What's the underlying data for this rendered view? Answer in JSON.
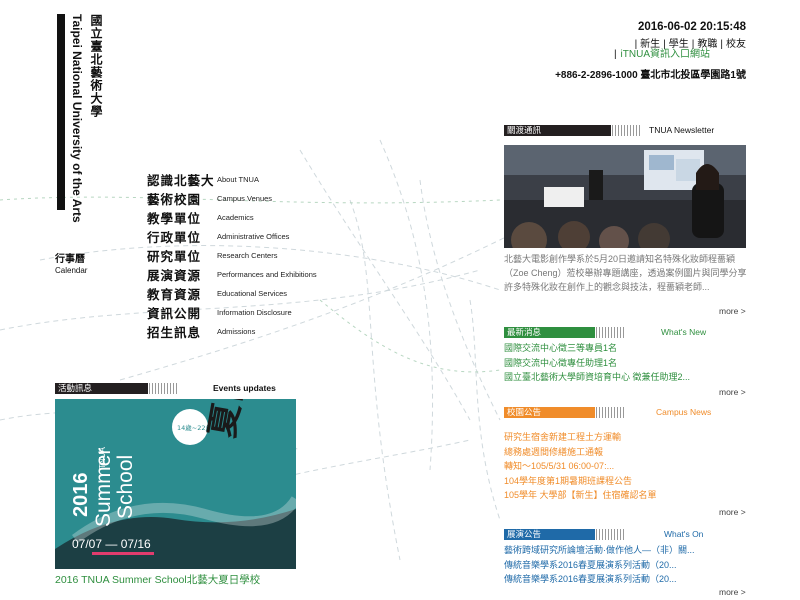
{
  "logo": {
    "name_zh": "國立臺北藝術大學",
    "name_en": "Taipei National University of the Arts"
  },
  "calendar": {
    "label_zh": "行事曆",
    "label_en": "Calendar"
  },
  "nav": [
    {
      "zh": "認識北藝大",
      "en": "About TNUA"
    },
    {
      "zh": "藝術校園",
      "en": "Campus Venues"
    },
    {
      "zh": "教學單位",
      "en": "Academics"
    },
    {
      "zh": "行政單位",
      "en": "Administrative Offices"
    },
    {
      "zh": "研究單位",
      "en": "Research Centers"
    },
    {
      "zh": "展演資源",
      "en": "Performances and Exhibitions"
    },
    {
      "zh": "教育資源",
      "en": "Educational Services"
    },
    {
      "zh": "資訊公開",
      "en": "Information Disclosure"
    },
    {
      "zh": "招生訊息",
      "en": "Admissions"
    }
  ],
  "header": {
    "datetime": "2016-06-02 20:15:48",
    "links": [
      "新生",
      "學生",
      "教職",
      "校友"
    ],
    "portal": "iTNUA資訊入口網站",
    "address": "+886-2-2896-1000 臺北市北投區學園路1號"
  },
  "newsletter": {
    "title_zh": "關渡通訊",
    "title_en": "TNUA Newsletter",
    "summary": "北藝大電影創作學系於5月20日邀請知名特殊化妝師程薔穎（Zoe Cheng）蒞校舉辦專題講座，透過案例圖片與同學分享許多特殊化妝在創作上的觀念與技法，程薔穎老師...",
    "more": "more >"
  },
  "whats_new": {
    "title_zh": "最新消息",
    "title_en": "What's New",
    "items": [
      "國際交流中心徵三等專員1名",
      "國際交流中心徵專任助理1名",
      "國立臺北藝術大學師資培育中心 徵兼任助理2..."
    ],
    "more": "more >"
  },
  "campus_news": {
    "title_zh": "校園公告",
    "title_en": "Campus News",
    "items": [
      "研究生宿舍新建工程土方運輸",
      "總務處週間修繕施工通報",
      "轉知～105/5/31 06:00-07:...",
      "104學年度第1期暑期班課程公告",
      "105學年 大學部【新生】住宿確認名單"
    ],
    "more": "more >"
  },
  "whats_on": {
    "title_zh": "展演公告",
    "title_en": "What's On",
    "items": [
      "藝術跨域研究所論壇活動·做作他人—（非）關...",
      "傳統音樂學系2016春夏展演系列活動（20...",
      "傳統音樂學系2016春夏展演系列活動（20..."
    ],
    "more": "more >"
  },
  "events": {
    "title_zh": "活動訊息",
    "title_en": "Events updates",
    "caption": "2016 TNUA Summer School北藝大夏日學校",
    "poster": {
      "year": "2016",
      "brand": "TNUA",
      "line1": "Summer",
      "line2": "School",
      "badge": "14歲~22歲",
      "dates": "07/07 — 07/16",
      "title_zh": "夏日學校"
    }
  },
  "colors": {
    "accent_green": "#2f8f3f",
    "accent_orange": "#f08c2a",
    "accent_blue": "#1f6aa8",
    "poster_teal": "#2c8c8f",
    "dark": "#231f20"
  }
}
